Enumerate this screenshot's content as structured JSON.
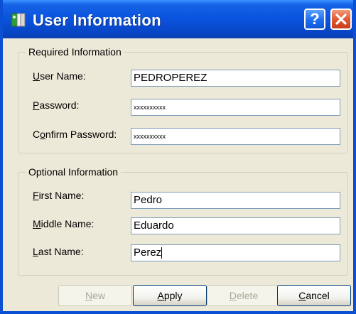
{
  "window": {
    "title": "User Information",
    "help_label": "?"
  },
  "required": {
    "legend": "Required Information",
    "user_name": {
      "label_mnemonic": "U",
      "label_rest": "ser Name:",
      "value": "PEDROPEREZ"
    },
    "password": {
      "label_mnemonic": "P",
      "label_rest": "assword:",
      "value": "xxxxxxxxxx"
    },
    "confirm": {
      "label_pre": "C",
      "label_mnemonic": "o",
      "label_rest": "nfirm Password:",
      "value": "xxxxxxxxxx"
    }
  },
  "optional": {
    "legend": "Optional Information",
    "first_name": {
      "label_mnemonic": "F",
      "label_rest": "irst Name:",
      "value": "Pedro"
    },
    "middle_name": {
      "label_mnemonic": "M",
      "label_rest": "iddle Name:",
      "value": "Eduardo"
    },
    "last_name": {
      "label_mnemonic": "L",
      "label_rest": "ast Name:",
      "value": "Perez"
    }
  },
  "buttons": {
    "new": {
      "mnemonic": "N",
      "rest": "ew",
      "enabled": false
    },
    "apply": {
      "mnemonic": "A",
      "rest": "pply",
      "enabled": true
    },
    "delete": {
      "mnemonic": "D",
      "rest": "elete",
      "enabled": false
    },
    "cancel": {
      "mnemonic": "C",
      "rest": "ancel",
      "enabled": true
    }
  },
  "colors": {
    "titlebar": "#0a53de",
    "window_bg": "#ece9d8",
    "close": "#e0542e",
    "input_border": "#7f9db9"
  }
}
